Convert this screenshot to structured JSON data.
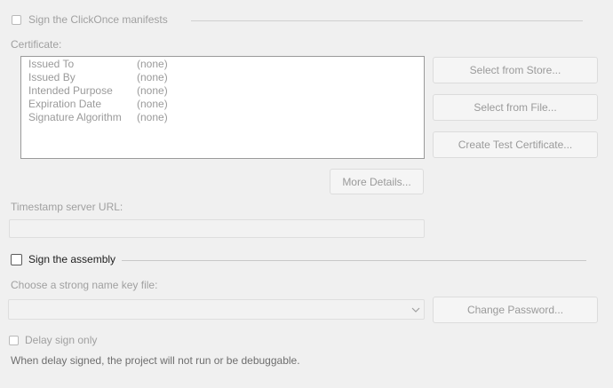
{
  "manifest": {
    "sign_label": "Sign the ClickOnce manifests",
    "certificate_label": "Certificate:",
    "rows": [
      {
        "key": "Issued To",
        "value": "(none)"
      },
      {
        "key": "Issued By",
        "value": "(none)"
      },
      {
        "key": "Intended Purpose",
        "value": "(none)"
      },
      {
        "key": "Expiration Date",
        "value": "(none)"
      },
      {
        "key": "Signature Algorithm",
        "value": "(none)"
      }
    ],
    "select_store_label": "Select from Store...",
    "select_file_label": "Select from File...",
    "create_test_label": "Create Test Certificate...",
    "more_details_label": "More Details...",
    "timestamp_label": "Timestamp server URL:",
    "timestamp_value": ""
  },
  "assembly": {
    "sign_label": "Sign the assembly",
    "key_file_label": "Choose a strong name key file:",
    "key_file_value": "",
    "change_password_label": "Change Password...",
    "delay_sign_label": "Delay sign only",
    "note": "When delay signed, the project will not run or be debuggable."
  }
}
